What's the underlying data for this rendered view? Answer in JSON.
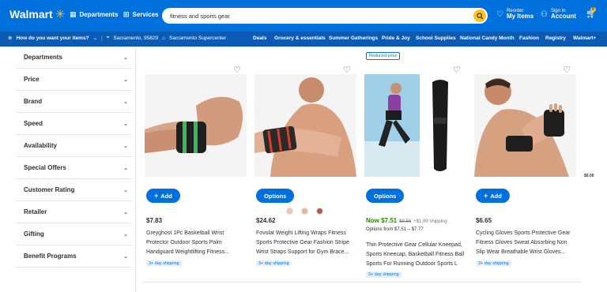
{
  "header": {
    "logo": "Walmart",
    "departments": "Departments",
    "services": "Services",
    "search_value": "fitness and sports gear",
    "reorder_small": "Reorder",
    "reorder_big": "My Items",
    "signin_small": "Sign In",
    "signin_big": "Account",
    "cart_count": "0",
    "cart_total": "$0.00"
  },
  "subbar": {
    "delivery_prompt": "How do you want your items?",
    "zip": "Sacramento, 95829",
    "store": "Sacramento Supercenter",
    "links": [
      "Deals",
      "Grocery & essentials",
      "Summer Gatherings",
      "Pride & Joy",
      "School Supplies",
      "National Candy Month",
      "Fashion",
      "Registry",
      "Walmart+"
    ]
  },
  "sidebar": {
    "facets": [
      "Departments",
      "Price",
      "Brand",
      "Speed",
      "Availability",
      "Special Offers",
      "Customer Rating",
      "Retailer",
      "Gifting",
      "Benefit Programs"
    ]
  },
  "products": [
    {
      "button": "Add",
      "price": "$7.83",
      "title": [
        "Greyghost 1Pc Basketball Wrist",
        "Protector Outdoor Sports Palm",
        "Handguard Weightlifting Fitness..."
      ],
      "ship": "3+ day shipping"
    },
    {
      "button": "Options",
      "price": "$24.62",
      "title": [
        "Fovolat Weight Lifting Wraps Fitness",
        "Sports Protective Gear Fashion Stripe",
        "Wrist Straps Support for Gym Brace..."
      ],
      "ship": "3+ day shipping"
    },
    {
      "badge": "Reduced price",
      "button": "Options",
      "price_now": "Now $7.51",
      "price_was": "$9.56",
      "price_ship": "+$1.99 shipping",
      "options": "Options from $7.51 – $7.77",
      "title": [
        "Thin Protective Gear Cellular Kneepad,",
        "Sports Kneecap, Basketball Fitness Ball",
        "Sports For Running Outdoor Sports L"
      ],
      "ship": "3+ day shipping"
    },
    {
      "button": "Add",
      "price": "$6.65",
      "title": [
        "Cycling Gloves Sports Protective Gear",
        "Fitness Gloves Sweat Absorbing Non",
        "Slip Wear Breathable Wrist Gloves..."
      ],
      "ship": "3+ day shipping"
    }
  ],
  "colors": {
    "brand_blue": "#0071dc",
    "nav_blue": "#0b5bb5",
    "spark_yellow": "#ffc220",
    "now_green": "#2a8703"
  }
}
